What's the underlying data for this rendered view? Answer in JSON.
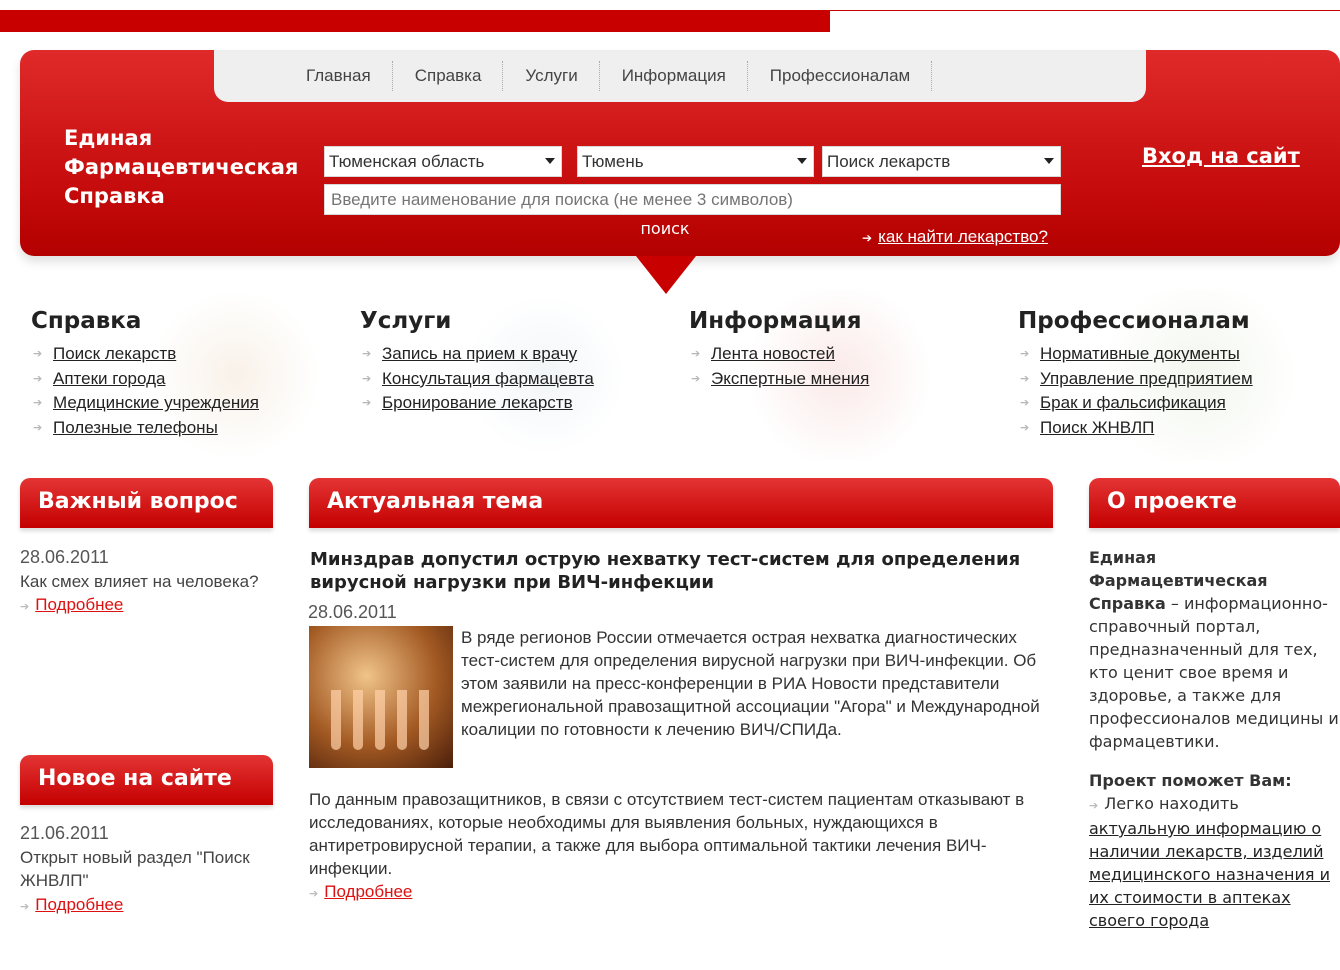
{
  "colors": {
    "accent": "#c90000",
    "nav_bg": "#efefef",
    "link": "#dd1111"
  },
  "topnav": [
    "Главная",
    "Справка",
    "Услуги",
    "Информация",
    "Профессионалам"
  ],
  "brand": {
    "line1": "Единая",
    "line2": "Фармацевтическая",
    "line3": "Справка"
  },
  "search": {
    "region": "Тюменская область",
    "city": "Тюмень",
    "type": "Поиск лекарств",
    "placeholder": "Введите наименование для поиска (не менее 3 символов)",
    "button": "поиск",
    "howto": "как найти лекарство?"
  },
  "login": "Вход на сайт",
  "categories": [
    {
      "title": "Справка",
      "links": [
        "Поиск лекарств",
        "Аптеки города",
        "Медицинские учреждения",
        "Полезные телефоны"
      ]
    },
    {
      "title": "Услуги",
      "links": [
        "Запись на прием к врачу",
        "Консультация фармацевта",
        "Бронирование лекарств"
      ]
    },
    {
      "title": "Информация",
      "links": [
        "Лента новостей",
        "Экспертные мнения"
      ]
    },
    {
      "title": "Профессионалам",
      "links": [
        "Нормативные документы",
        "Управление предприятием",
        "Брак и фальсификация",
        "Поиск ЖНВЛП"
      ]
    }
  ],
  "important": {
    "header": "Важный вопрос",
    "date": "28.06.2011",
    "text": "Как смех влияет на человека?",
    "more": "Подробнее"
  },
  "new_on_site": {
    "header": "Новое на сайте",
    "date": "21.06.2011",
    "text": "Открыт новый раздел \"Поиск ЖНВЛП\"",
    "more": "Подробнее"
  },
  "topic": {
    "header": "Актуальная тема",
    "title": "Минздрав допустил острую нехватку тест-систем для определения вирусной нагрузки при ВИЧ-инфекции",
    "date": "28.06.2011",
    "lead": "В ряде регионов России отмечается острая нехватка диагностических тест-систем для определения вирусной нагрузки при ВИЧ-инфекции. Об этом заявили на пресс-конференции в РИА Новости представители межрегиональной правозащитной ассоциации \"Агора\" и Международной коалиции по готовности к лечению ВИЧ/СПИДа.",
    "body": "По данным правозащитников, в связи с отсутствием тест-систем пациентам отказывают в исследованиях, которые необходимы для выявления больных, нуждающихся в антиретровирусной терапии, а также для выбора оптимальной тактики лечения ВИЧ-инфекции.",
    "more": "Подробнее"
  },
  "about": {
    "header": "О проекте",
    "name": "Единая Фармацевтическая Справка",
    "desc": " – информационно-справочный портал, предназначенный для тех, кто ценит свое время и здоровье, а также для профессионалов медицины и фармацевтики.",
    "help_title": "Проект поможет Вам:",
    "help_item": "Легко находить",
    "help_link": "актуальную информацию о наличии лекарств, изделий медицинского назначения и их стоимости в аптеках своего города"
  }
}
